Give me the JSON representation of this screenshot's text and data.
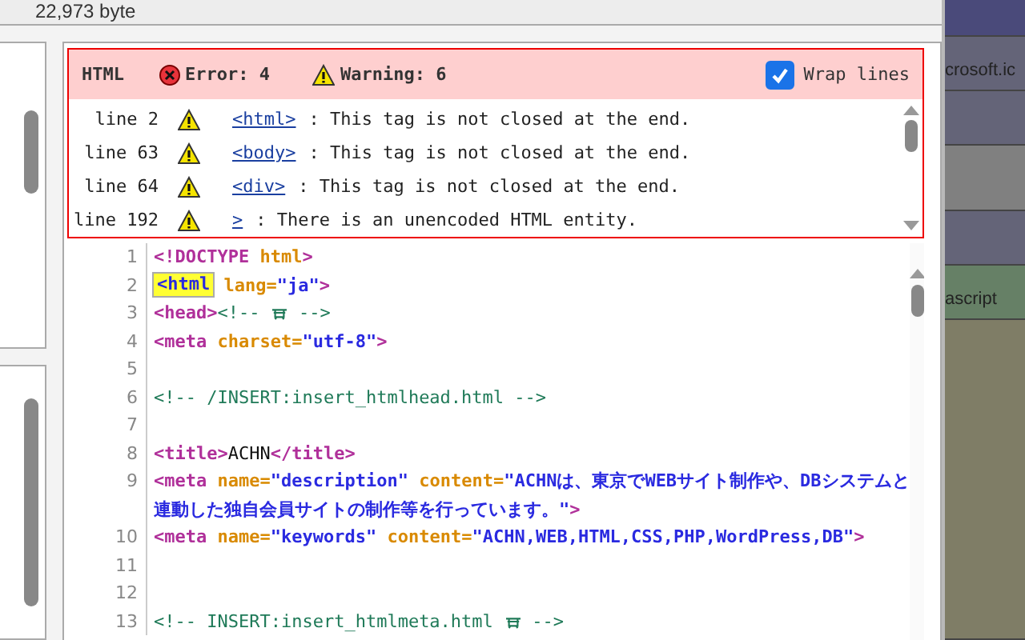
{
  "status_bar": {
    "size": "22,973 byte"
  },
  "validation": {
    "language": "HTML",
    "error_count": "Error: 4",
    "warning_count": "Warning: 6",
    "wrap_lines": {
      "label": "Wrap lines",
      "checked": true
    },
    "messages": [
      {
        "line": "line 2",
        "kind": "warning",
        "tag": "<html>",
        "text": ": This tag is not closed at the end."
      },
      {
        "line": "line 63",
        "kind": "warning",
        "tag": "<body>",
        "text": ": This tag is not closed at the end."
      },
      {
        "line": "line 64",
        "kind": "warning",
        "tag": "<div>",
        "text": ": This tag is not closed at the end."
      },
      {
        "line": "line 192",
        "kind": "warning",
        "tag": ">",
        "text": ": There is an unencoded HTML entity."
      }
    ]
  },
  "editor": {
    "lines": [
      {
        "number": "1",
        "rows": [
          [
            {
              "kind": "tag",
              "text": "<!DOCTYPE "
            },
            {
              "kind": "attr",
              "text": "html"
            },
            {
              "kind": "tag",
              "text": ">"
            }
          ]
        ]
      },
      {
        "number": "2",
        "rows": [
          [
            {
              "kind": "tag",
              "text": "<html",
              "highlighted": true
            },
            {
              "kind": "attr",
              "text": " lang="
            },
            {
              "kind": "value",
              "text": "\"ja\""
            },
            {
              "kind": "tag",
              "text": ">"
            }
          ]
        ]
      },
      {
        "number": "3",
        "rows": [
          [
            {
              "kind": "tag",
              "text": "<head>"
            },
            {
              "kind": "comment",
              "text": "<!-- "
            },
            {
              "kind": "icon"
            },
            {
              "kind": "comment",
              "text": " -->"
            }
          ]
        ]
      },
      {
        "number": "4",
        "rows": [
          [
            {
              "kind": "tag",
              "text": "<meta "
            },
            {
              "kind": "attr",
              "text": "charset="
            },
            {
              "kind": "value",
              "text": "\"utf-8\""
            },
            {
              "kind": "tag",
              "text": ">"
            }
          ]
        ]
      },
      {
        "number": "5",
        "rows": [
          []
        ]
      },
      {
        "number": "6",
        "rows": [
          [
            {
              "kind": "comment",
              "text": "<!-- /INSERT:insert_htmlhead.html -->"
            }
          ]
        ]
      },
      {
        "number": "7",
        "rows": [
          []
        ]
      },
      {
        "number": "8",
        "rows": [
          [
            {
              "kind": "tag",
              "text": "<title>"
            },
            {
              "kind": "text",
              "text": "ACHN"
            },
            {
              "kind": "tag",
              "text": "</title>"
            }
          ]
        ]
      },
      {
        "number": "9",
        "rows": [
          [
            {
              "kind": "tag",
              "text": "<meta "
            },
            {
              "kind": "attr",
              "text": "name="
            },
            {
              "kind": "value",
              "text": "\"description\""
            },
            {
              "kind": "attr",
              "text": " content="
            },
            {
              "kind": "value",
              "text": "\"ACHNは、東京でWEBサイト制作や、DBシステムと"
            },
            {
              "kind": "value",
              "text": "連動した独自会員サイトの制作等を行っています。\"",
              "wrapped": true
            },
            {
              "kind": "tag",
              "text": ">"
            }
          ]
        ]
      },
      {
        "number": "10",
        "rows": [
          [
            {
              "kind": "tag",
              "text": "<meta "
            },
            {
              "kind": "attr",
              "text": "name="
            },
            {
              "kind": "value",
              "text": "\"keywords\""
            },
            {
              "kind": "attr",
              "text": " content="
            },
            {
              "kind": "value",
              "text": "\"ACHN,WEB,HTML,CSS,PHP,WordPress,DB\""
            },
            {
              "kind": "tag",
              "text": ">"
            }
          ]
        ]
      },
      {
        "number": "11",
        "rows": [
          []
        ]
      },
      {
        "number": "12",
        "rows": [
          []
        ]
      },
      {
        "number": "13",
        "rows": [
          [
            {
              "kind": "comment",
              "text": "<!-- INSERT:insert_htmlmeta.html "
            },
            {
              "kind": "icon"
            },
            {
              "kind": "comment",
              "text": " -->"
            }
          ]
        ]
      }
    ]
  },
  "background_window": {
    "texts": [
      "crosoft.ic",
      "ascript"
    ]
  }
}
